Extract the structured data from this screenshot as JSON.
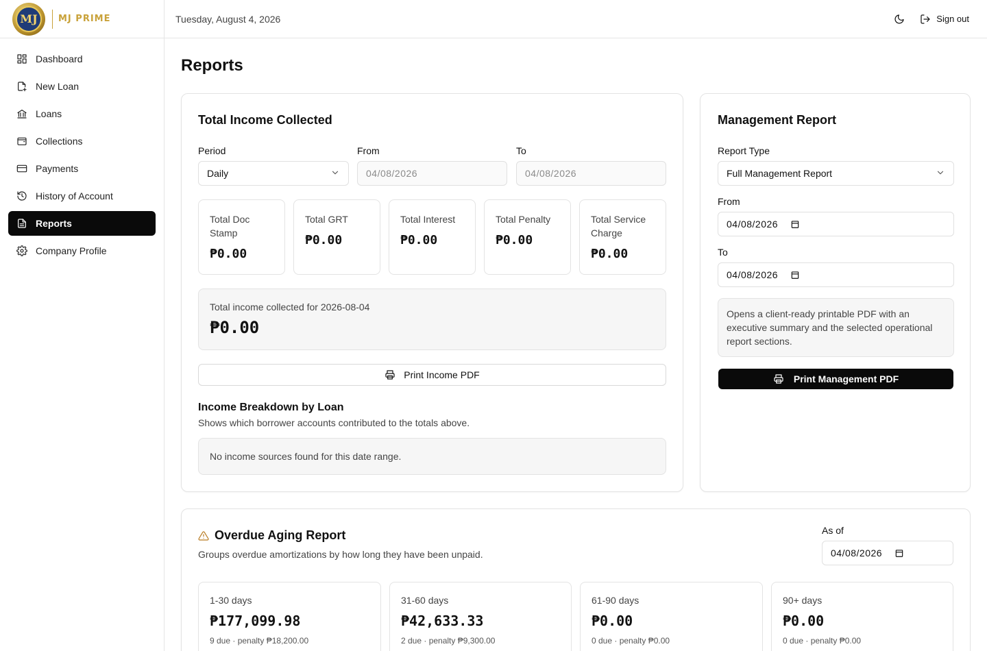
{
  "brand": {
    "name": "MJ PRIME",
    "logo_text": "MJ",
    "color": "#c9a23a"
  },
  "sidebar": {
    "items": [
      {
        "label": "Dashboard",
        "icon": "dashboard-icon"
      },
      {
        "label": "New Loan",
        "icon": "new-file-icon"
      },
      {
        "label": "Loans",
        "icon": "bank-icon"
      },
      {
        "label": "Collections",
        "icon": "wallet-icon"
      },
      {
        "label": "Payments",
        "icon": "credit-card-icon"
      },
      {
        "label": "History of Account",
        "icon": "history-icon"
      },
      {
        "label": "Reports",
        "icon": "report-icon",
        "active": true
      },
      {
        "label": "Company Profile",
        "icon": "gear-icon"
      }
    ]
  },
  "header": {
    "date": "Tuesday, August 4, 2026",
    "theme_icon": "moon-icon",
    "signout_label": "Sign out"
  },
  "page": {
    "title": "Reports"
  },
  "income": {
    "title": "Total Income Collected",
    "period_label": "Period",
    "period_value": "Daily",
    "from_label": "From",
    "from_value": "04/08/2026",
    "to_label": "To",
    "to_value": "04/08/2026",
    "stats": [
      {
        "label": "Total Doc Stamp",
        "value": "₱0.00"
      },
      {
        "label": "Total GRT",
        "value": "₱0.00"
      },
      {
        "label": "Total Interest",
        "value": "₱0.00"
      },
      {
        "label": "Total Penalty",
        "value": "₱0.00"
      },
      {
        "label": "Total Service Charge",
        "value": "₱0.00"
      }
    ],
    "summary_label": "Total income collected for 2026-08-04",
    "summary_value": "₱0.00",
    "print_label": "Print Income PDF",
    "breakdown_title": "Income Breakdown by Loan",
    "breakdown_sub": "Shows which borrower accounts contributed to the totals above.",
    "empty_text": "No income sources found for this date range."
  },
  "management": {
    "title": "Management Report",
    "type_label": "Report Type",
    "type_value": "Full Management Report",
    "from_label": "From",
    "from_value": "04/08/2026",
    "to_label": "To",
    "to_value": "04/08/2026",
    "info": "Opens a client-ready printable PDF with an executive summary and the selected operational report sections.",
    "print_label": "Print Management PDF"
  },
  "aging": {
    "title": "Overdue Aging Report",
    "subtitle": "Groups overdue amortizations by how long they have been unpaid.",
    "asof_label": "As of",
    "asof_value": "04/08/2026",
    "buckets": [
      {
        "label": "1-30 days",
        "value": "₱177,099.98",
        "meta": "9 due · penalty ₱18,200.00"
      },
      {
        "label": "31-60 days",
        "value": "₱42,633.33",
        "meta": "2 due · penalty ₱9,300.00"
      },
      {
        "label": "61-90 days",
        "value": "₱0.00",
        "meta": "0 due · penalty ₱0.00"
      },
      {
        "label": "90+ days",
        "value": "₱0.00",
        "meta": "0 due · penalty ₱0.00"
      }
    ]
  }
}
